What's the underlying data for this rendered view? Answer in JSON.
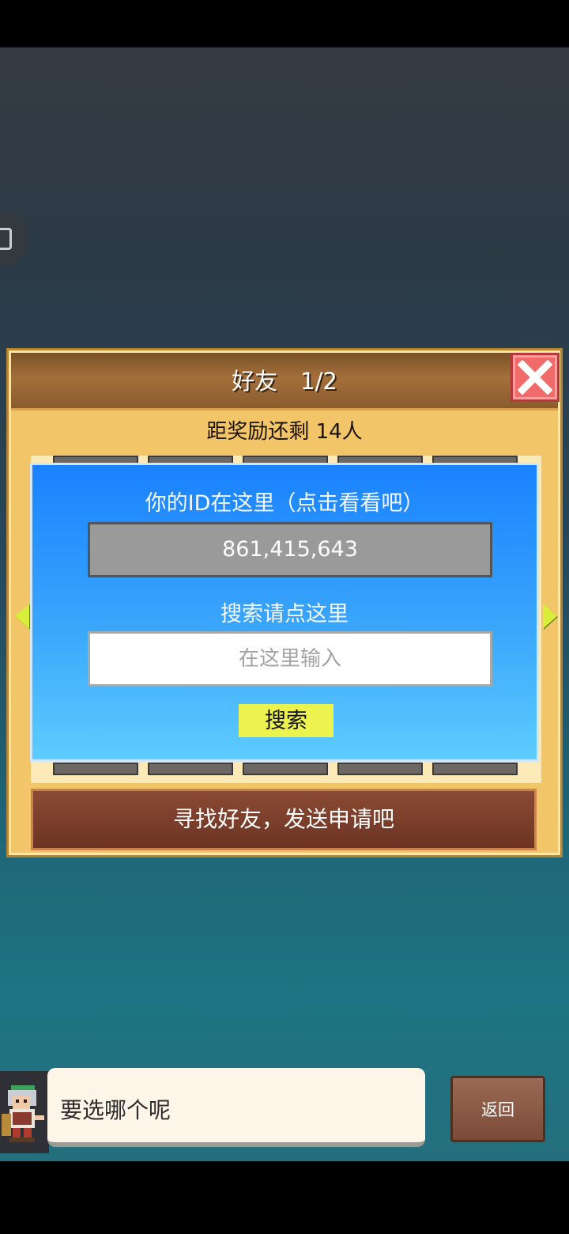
{
  "panel": {
    "title": "好友　1/2",
    "reward_text": "距奖励还剩 14人",
    "find_friends_label": "寻找好友，发送申请吧"
  },
  "id_dialog": {
    "id_label": "你的ID在这里（点击看看吧）",
    "id_value": "861,415,643",
    "search_label": "搜索请点这里",
    "search_placeholder": "在这里输入",
    "search_value": "",
    "search_button": "搜索"
  },
  "bottom": {
    "speech_text": "要选哪个呢",
    "back_button": "返回"
  },
  "icons": {
    "close": "close-icon",
    "arrow_left": "arrow-left-icon",
    "arrow_right": "arrow-right-icon",
    "avatar": "character-avatar"
  },
  "colors": {
    "dialog_blue": "#1a82ff",
    "search_button_yellow": "#ecf24e",
    "panel_gold": "#f1c568",
    "close_red": "#f26b6b"
  }
}
